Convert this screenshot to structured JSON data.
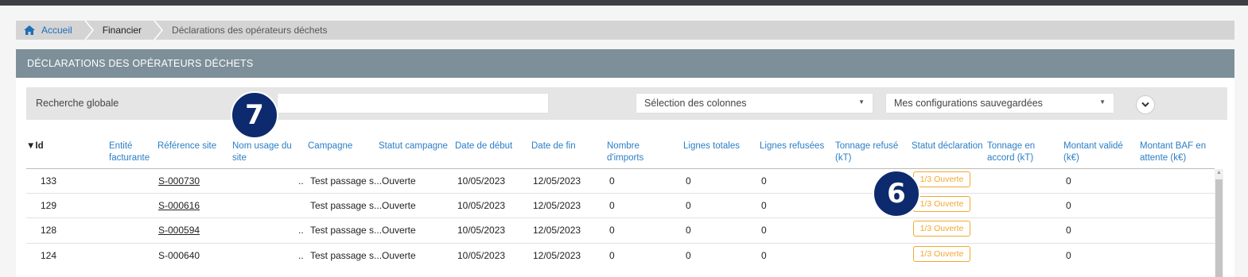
{
  "breadcrumb": {
    "home": "Accueil",
    "financier": "Financier",
    "current": "Déclarations des opérateurs déchets"
  },
  "panel": {
    "title": "DÉCLARATIONS DES OPÉRATEURS DÉCHETS"
  },
  "search": {
    "label": "Recherche globale",
    "value": "",
    "columns_select": "Sélection des colonnes",
    "configs_select": "Mes configurations sauvegardées"
  },
  "callouts": {
    "seven": "7",
    "six": "6"
  },
  "table": {
    "headers": {
      "id": "Id",
      "entite1": "Entité",
      "entite2": "facturante",
      "reference": "Référence site",
      "nom1": "Nom usage du",
      "nom2": "site",
      "campagne": "Campagne",
      "statut_campagne": "Statut campagne",
      "date_debut": "Date de début",
      "date_fin": "Date de fin",
      "nb1": "Nombre",
      "nb2": "d'imports",
      "lignes_totales": "Lignes totales",
      "lignes_refusees": "Lignes refusées",
      "tonnage_ref1": "Tonnage refusé",
      "tonnage_ref2": "(kT)",
      "statut_decl": "Statut déclaration",
      "tonnage_acc1": "Tonnage en",
      "tonnage_acc2": "accord (kT)",
      "montant_val1": "Montant validé",
      "montant_val2": "(k€)",
      "montant_baf1": "Montant BAF en",
      "montant_baf2": "attente (k€)"
    },
    "rows": [
      {
        "id": "133",
        "reference": "S-000730",
        "campagne_prefix": "..",
        "campagne": "Test passage s...",
        "statut_campagne": "Ouverte",
        "date_debut": "10/05/2023",
        "date_fin": "12/05/2023",
        "nb_imports": "0",
        "lignes_totales": "0",
        "lignes_refusees": "0",
        "statut_decl": "1/3 Ouverte",
        "montant_valide": "0"
      },
      {
        "id": "129",
        "reference": "S-000616",
        "campagne_prefix": "",
        "campagne": "Test passage s...",
        "statut_campagne": "Ouverte",
        "date_debut": "10/05/2023",
        "date_fin": "12/05/2023",
        "nb_imports": "0",
        "lignes_totales": "0",
        "lignes_refusees": "0",
        "statut_decl": "1/3 Ouverte",
        "montant_valide": "0"
      },
      {
        "id": "128",
        "reference": "S-000594",
        "campagne_prefix": "..",
        "campagne": "Test passage s...",
        "statut_campagne": "Ouverte",
        "date_debut": "10/05/2023",
        "date_fin": "12/05/2023",
        "nb_imports": "0",
        "lignes_totales": "0",
        "lignes_refusees": "0",
        "statut_decl": "1/3 Ouverte",
        "montant_valide": "0"
      },
      {
        "id": "124",
        "reference": "S-000640",
        "campagne_prefix": "..",
        "campagne": "Test passage s...",
        "statut_campagne": "Ouverte",
        "date_debut": "10/05/2023",
        "date_fin": "12/05/2023",
        "nb_imports": "0",
        "lignes_totales": "0",
        "lignes_refusees": "0",
        "statut_decl": "1/3 Ouverte",
        "montant_valide": "0"
      }
    ]
  },
  "colors": {
    "link_blue": "#2a7ec6",
    "panel_header": "#7d8f99",
    "status_orange": "#f0a830",
    "callout_navy": "#0d2a6e"
  }
}
